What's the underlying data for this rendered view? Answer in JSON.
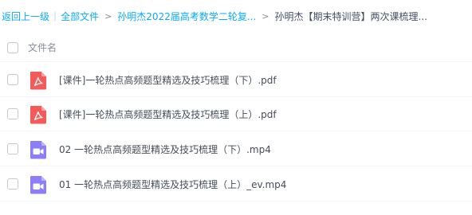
{
  "breadcrumb": {
    "back": "返回上一级",
    "sep1": "|",
    "all_files": "全部文件",
    "sep2": ">",
    "folder": "孙明杰2022届高考数学二轮复...",
    "sep3": ">",
    "current": "孙明杰【期末特训营】两次课梳理..."
  },
  "list": {
    "header_label": "文件名",
    "files": [
      {
        "name": "[课件]一轮热点高频题型精选及技巧梳理（下）.pdf",
        "icon": "pdf-icon"
      },
      {
        "name": "[课件]一轮热点高频题型精选及技巧梳理（上）.pdf",
        "icon": "pdf-icon"
      },
      {
        "name": "02 一轮热点高频题型精选及技巧梳理（下）.mp4",
        "icon": "video-icon"
      },
      {
        "name": "01 一轮热点高频题型精选及技巧梳理（上）_ev.mp4",
        "icon": "video-icon"
      }
    ]
  },
  "colors": {
    "link": "#09aaff",
    "pdf_red": "#f45a5a",
    "video_purple": "#8c7ef9"
  }
}
